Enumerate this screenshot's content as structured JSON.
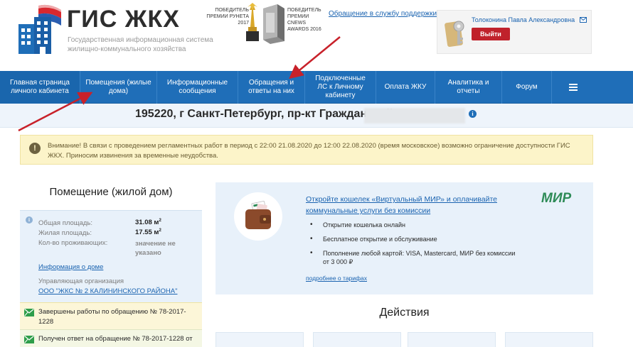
{
  "header": {
    "logo_title": "ГИС ЖКХ",
    "logo_subtitle": "Государственная информационная система жилищно-коммунального хозяйства",
    "award1_text": "ПОБЕДИТЕЛЬ ПРЕМИИ РУНЕТА 2017",
    "award2_text": "ПОБЕДИТЕЛЬ ПРЕМИИ CNEWS AWARDS 2016",
    "support_link": "Обращение в службу поддержки",
    "user_name": "Толоконина Павла Александровна",
    "logout_label": "Выйти"
  },
  "nav": {
    "items": [
      {
        "label": "Главная страница личного кабинета"
      },
      {
        "label": "Помещения (жилые дома)"
      },
      {
        "label": "Информационные сообщения"
      },
      {
        "label": "Обращения и ответы на них"
      },
      {
        "label": "Подключенные ЛС к Личному кабинету"
      },
      {
        "label": "Оплата ЖКУ"
      },
      {
        "label": "Аналитика и отчеты"
      },
      {
        "label": "Форум"
      }
    ],
    "menu_icon": "hamburger-icon"
  },
  "address": {
    "text": "195220, г Санкт-Петербург, пр-кт Гражданский,",
    "info_glyph": "i"
  },
  "warning": {
    "glyph": "!",
    "text": "Внимание! В связи с проведением регламентных работ в период с 22:00 21.08.2020 до 12:00 22.08.2020 (время московское) возможно ограничение доступности ГИС ЖКХ. Приносим извинения за временные неудобства."
  },
  "premises": {
    "title": "Помещение (жилой дом)",
    "info_glyph": "i",
    "total_area_label": "Общая площадь:",
    "total_area_value": "31.08 м",
    "living_area_label": "Жилая площадь:",
    "living_area_value": "17.55 м",
    "area_unit_sup": "2",
    "residents_label": "Кол-во проживающих:",
    "residents_value": "значение не указано",
    "house_info_link": "Информация о доме",
    "mgmt_label": "Управляющая организация",
    "mgmt_link": "ООО \"ЖКС № 2 КАЛИНИНСКОГО РАЙОНА\""
  },
  "events": [
    {
      "text": "Завершены работы по обращению № 78-2017-1228"
    },
    {
      "text": "Получен ответ на обращение № 78-2017-1228 от"
    }
  ],
  "promo": {
    "link": "Откройте кошелек «Виртуальный МИР» и оплачивайте коммунальные услуги без комиссии",
    "brand": "МИР",
    "bullets": [
      "Открытие кошелька онлайн",
      "Бесплатное открытие и обслуживание",
      "Пополнение любой картой: VISA, Mastercard, МИР без комиссии от 3 000 ₽"
    ],
    "tariffs_link": "подробнее о тарифах"
  },
  "actions": {
    "title": "Действия"
  },
  "colors": {
    "nav_blue": "#1f6eb8",
    "link_blue": "#1a63b0",
    "logout_red": "#c0222b",
    "warning_bg": "#fcf4c9",
    "panel_bg": "#e8f1fa",
    "mir_green": "#2e8b57",
    "arrow_red": "#c8212a"
  }
}
